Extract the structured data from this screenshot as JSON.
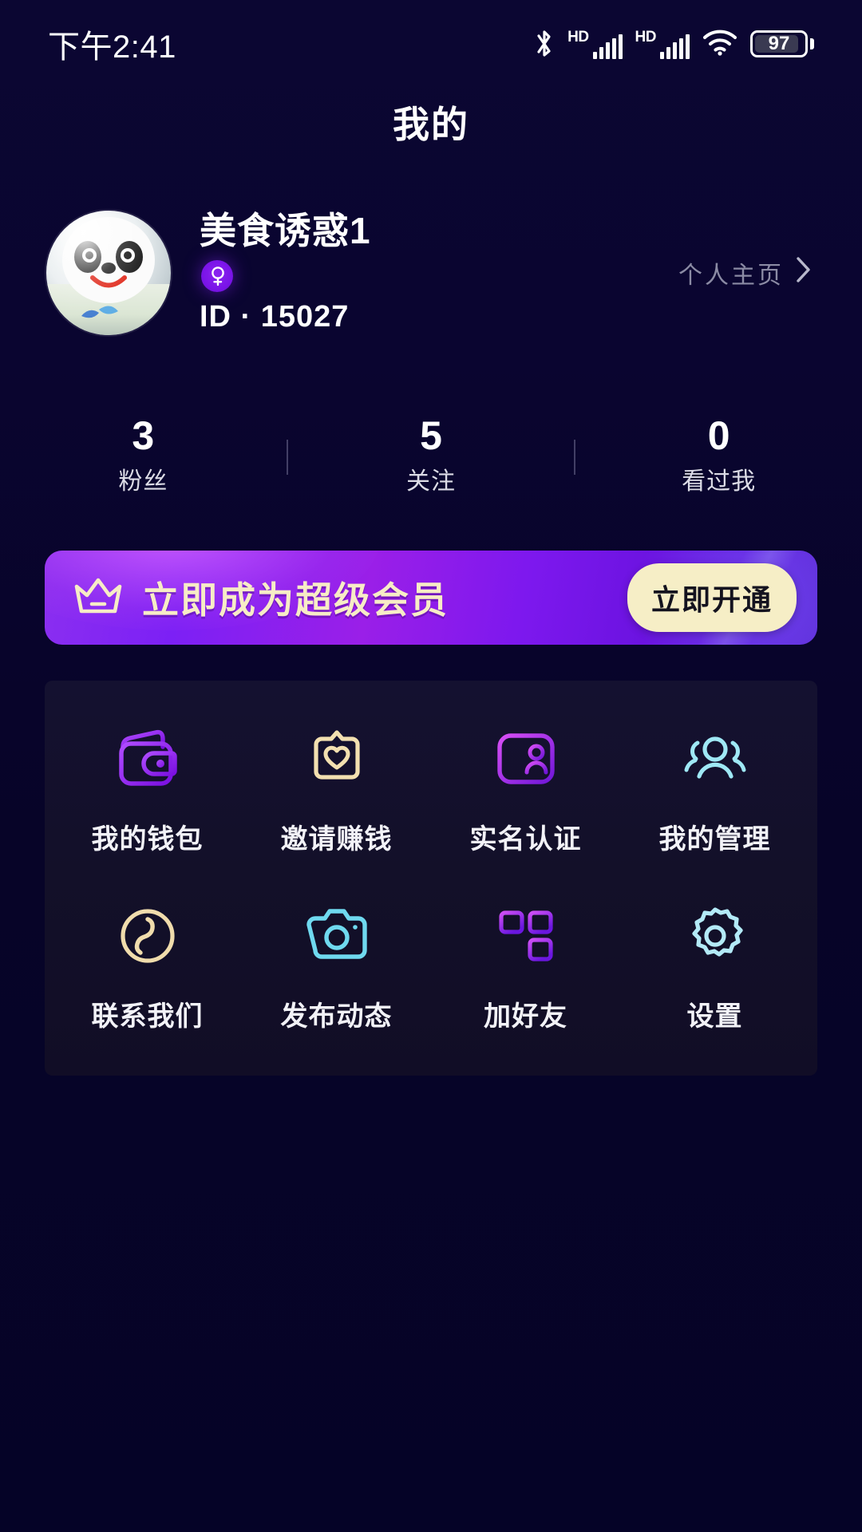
{
  "status_bar": {
    "time": "下午2:41",
    "bluetooth_icon": "bluetooth-icon",
    "sim1_hd": "HD",
    "sim2_hd": "HD",
    "wifi_icon": "wifi-icon",
    "battery_level": "97"
  },
  "header": {
    "title": "我的"
  },
  "profile": {
    "avatar_name": "avatar-panda",
    "username": "美食诱惑1",
    "gender_symbol": "♀",
    "gender_name": "female-gender-badge",
    "user_id": "ID · 15027",
    "homepage_label": "个人主页",
    "chevron_icon": "chevron-right-icon"
  },
  "stats": [
    {
      "value": "3",
      "label": "粉丝"
    },
    {
      "value": "5",
      "label": "关注"
    },
    {
      "value": "0",
      "label": "看过我"
    }
  ],
  "vip_banner": {
    "crown_icon": "crown-icon",
    "text": "立即成为超级会员",
    "button_label": "立即开通",
    "gradient_start": "#8b2ff0",
    "gradient_end": "#5d2bd6",
    "text_color": "#f7ecc6",
    "button_bg": "#f6eec6"
  },
  "grid": [
    {
      "label": "我的钱包",
      "icon": "wallet-icon",
      "color": "#9b2ff5"
    },
    {
      "label": "邀请赚钱",
      "icon": "invite-heart-icon",
      "color": "#f3e0b0"
    },
    {
      "label": "实名认证",
      "icon": "id-card-icon",
      "color": "#c53df0"
    },
    {
      "label": "我的管理",
      "icon": "users-icon",
      "color": "#9fe8f5"
    },
    {
      "label": "联系我们",
      "icon": "phone-icon",
      "color": "#f0dcac"
    },
    {
      "label": "发布动态",
      "icon": "camera-icon",
      "color": "#6fd9ef"
    },
    {
      "label": "加好友",
      "icon": "qrcode-icon",
      "color": "#a930f0"
    },
    {
      "label": "设置",
      "icon": "gear-icon",
      "color": "#b3eaf7"
    }
  ]
}
